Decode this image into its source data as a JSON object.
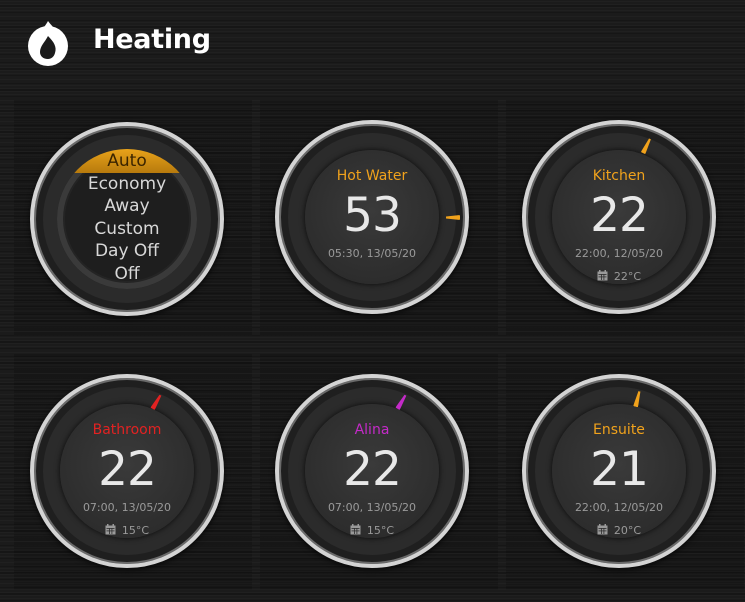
{
  "header": {
    "title": "Heating",
    "icon": "flame-icon"
  },
  "mode_selector": {
    "options": [
      "Auto",
      "Economy",
      "Away",
      "Custom",
      "Day Off",
      "Off"
    ],
    "selected": "Auto",
    "accent": "#e8a21a"
  },
  "zones": [
    {
      "name": "Hot Water",
      "value": "53",
      "time": "05:30, 13/05/20",
      "setpoint": "",
      "color": "#f0a21c"
    },
    {
      "name": "Kitchen",
      "value": "22",
      "time": "22:00, 12/05/20",
      "setpoint": "22°C",
      "color": "#f0a21c"
    },
    {
      "name": "Bathroom",
      "value": "22",
      "time": "07:00, 13/05/20",
      "setpoint": "15°C",
      "color": "#e22222"
    },
    {
      "name": "Alina",
      "value": "22",
      "time": "07:00, 13/05/20",
      "setpoint": "15°C",
      "color": "#c42ac8"
    },
    {
      "name": "Ensuite",
      "value": "21",
      "time": "22:00, 12/05/20",
      "setpoint": "20°C",
      "color": "#f0a21c"
    }
  ]
}
